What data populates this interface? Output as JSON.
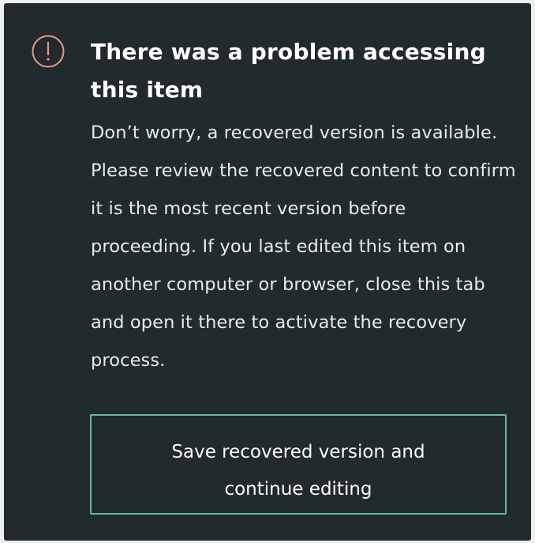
{
  "dialog": {
    "icon": "exclamation-circle-icon",
    "icon_color": "#e89a8c",
    "accent_color": "#66b5ad",
    "background_color": "#212a2c",
    "title": "There was a problem accessing this item",
    "message": "Don’t worry, a recovered version is available. Please review the recovered content to confirm it is the most recent version before proceeding. If you last edited this item on another computer or browser, close this tab and open it there to activate the recovery process.",
    "primary_button_label": "Save recovered version and continue editing"
  }
}
